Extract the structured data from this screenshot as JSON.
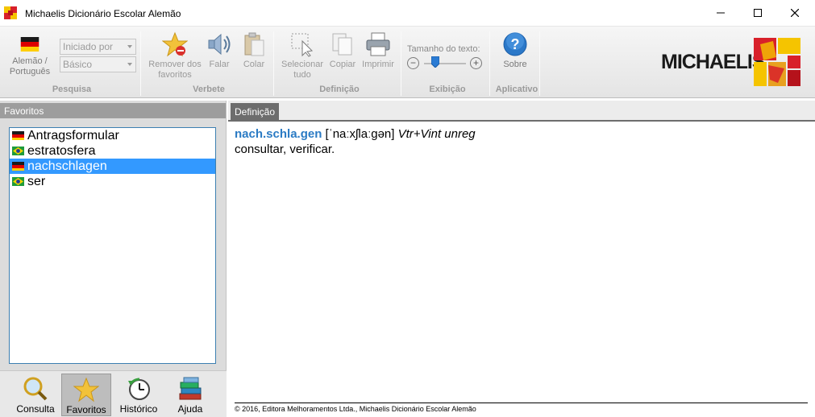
{
  "window": {
    "title": "Michaelis Dicionário Escolar Alemão"
  },
  "ribbon": {
    "pesquisa": {
      "language_button": "Alemão / Português",
      "search_mode": "Iniciado por",
      "level": "Básico",
      "group_label": "Pesquisa"
    },
    "verbete": {
      "remove_favorites": "Remover dos favoritos",
      "speak": "Falar",
      "paste": "Colar",
      "group_label": "Verbete"
    },
    "definicao": {
      "select_all": "Selecionar tudo",
      "copy": "Copiar",
      "print": "Imprimir",
      "group_label": "Definição"
    },
    "exibicao": {
      "text_size_label": "Tamanho do texto:",
      "decrease": "−",
      "increase": "+",
      "text_size_level": 0.25,
      "group_label": "Exibição"
    },
    "aplicativo": {
      "about": "Sobre",
      "group_label": "Aplicativo"
    },
    "brand": "MICHAELIS"
  },
  "left_pane": {
    "header": "Favoritos",
    "favorites": [
      {
        "word": "Antragsformular",
        "flag": "germany-flag"
      },
      {
        "word": "estratosfera",
        "flag": "brazil-flag"
      },
      {
        "word": "nachschlagen",
        "flag": "germany-flag",
        "selected": true
      },
      {
        "word": "ser",
        "flag": "brazil-flag"
      }
    ],
    "nav": {
      "consulta": "Consulta",
      "favoritos": "Favoritos",
      "historico": "Histórico",
      "ajuda": "Ajuda"
    }
  },
  "right_pane": {
    "tab": "Definição",
    "entry": {
      "headword": "nach.schla.gen",
      "pronunciation": "[ˈnaːxʃlaːgən]",
      "grammar": "Vtr+Vint unreg",
      "definition": "consultar, verificar."
    },
    "footer": "© 2016, Editora Melhoramentos Ltda., Michaelis Dicionário Escolar Alemão"
  },
  "colors": {
    "headword": "#2b7bc4",
    "selection": "#3399ff",
    "tab": "#6d6d6d",
    "pane_header": "#9d9d9d"
  }
}
